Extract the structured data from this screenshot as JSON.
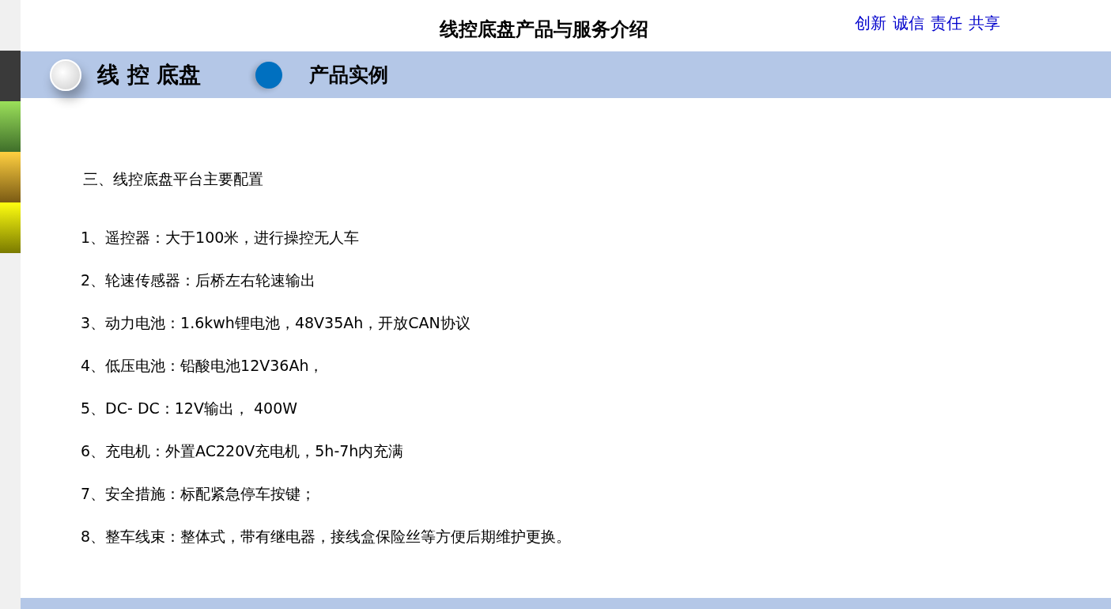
{
  "header": {
    "title": "线控底盘产品与服务介绍",
    "motto": [
      "创新",
      "诚信",
      "责任",
      "共享"
    ]
  },
  "banner": {
    "section": "线 控 底盘",
    "subsection": "产品实例"
  },
  "content": {
    "heading": "三、线控底盘平台主要配置",
    "items": [
      "1、遥控器：大于100米，进行操控无人车",
      "2、轮速传感器：后桥左右轮速输出",
      "3、动力电池：1.6kwh锂电池，48V35Ah，开放CAN协议",
      "4、低压电池：铅酸电池12V36Ah，",
      "5、DC- DC：12V输出， 400W",
      "6、充电机：外置AC220V充电机，5h-7h内充满",
      "7、安全措施：标配紧急停车按键；",
      "8、整车线束：整体式，带有继电器，接线盒保险丝等方便后期维护更换。"
    ]
  }
}
